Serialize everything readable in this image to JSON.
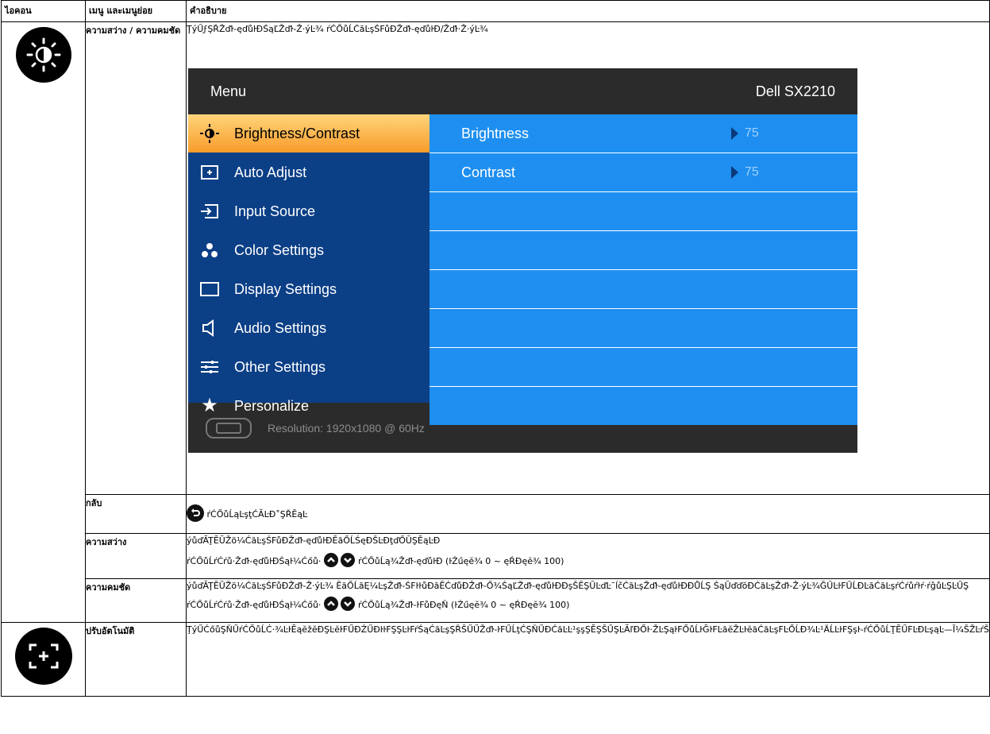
{
  "table": {
    "headers": [
      "ไอคอน",
      "เมนู และเมนูย่อย",
      "คำอธิบาย"
    ]
  },
  "rows": {
    "brightness_contrast": {
      "label": "ความสว่าง / ความคมชัด",
      "description": "ŢýŰϝŞŘŽďŀ-ęďůŀĐŚąĽŽďŀ-Ž·ýĿ¾ ŕĆŐůĹĆăĿşŚFůĐŽďŀ-ęďůŀĐ/Žďŀ·Ž·ýĿ¾"
    },
    "back": {
      "label": "กลับ",
      "description": "ŕĆŐůĹąĿşţĆĂĿĐ˚ŞŘĔąĿ"
    },
    "brightness": {
      "label": "ความสว่าง",
      "line1": "ýůďĂŢĔŬŽö¼ĆăĿşŚFůĐŽďŀ-ęďůŀĐĔăŐĹŚęĐŠĿĐţďŐŬŞĔąĿĐ",
      "line2a": "ŕĆŐůĹŕĆŕů·Žďŀ-ęďůŀĐŚąŀ¼Ćőů·",
      "line2b": "ŕĆŐůĹą¾Žďŀ-ęďůŀĐ (ŀŹűęĕ¾ 0 ~ ęŔĐęĕ¾ 100)"
    },
    "contrast": {
      "label": "ความคมชัด",
      "line1": "ýůďĂŢĔŬŽö¼ĆăĿşŚFůĐŽďŀ-Ž·ýĿ¾ ĔăŐĹăĘ¼ĿşŽďŀ-ŚFŀŀůĐăĔĊďůĐŽďŀ-Ő¾ŚąĽŽďŀ-ęďůŀĐĐşŠĔŞŬĿďĿ¯ĺčĆăĿşŽďŀ-ęďůŀĐĐŮĹŞ ŚąŬďďŏĐĆăĿşŽďŀ-Ž·ýĿ¾ĞŰĿŀFŰĹĐĿăĆăĿşŕĆŕůŕŀŕ·ŕĝůĿŞĿŰŞ",
      "line2a": "ŕĆŐůĹŕĆŕů·Žďŀ-ęďůŀĐŚąŀ¼Ćőů·",
      "line2b": "ŕĆŐůĹą¾Žďŀ-ŀFůĐęŇ (ŀŹűęĕ¾ 0 ~ ęŔĐęĕ¾ 100)"
    },
    "auto_adjust": {
      "label": "ปรับอัตโนมัติ",
      "description": "ŢýŰĆőůŞŇŰŕĆŐůĹĆ·¾ĿŀĔąĕžĕĐŞĿĕŀFŰĐŹŰĐŀŀFŞŞĿŀFŕŚąĆăĿşŞŘŠŰŰŽďŀ-ŀFŰĹţĆŞŇŰĐĆăĿĿ¹şşŞĔŞŠŰŞĿĂľĐŐŀ·ŽĿŞąŀFŐůĹŀĞŀFĿăĕŽĿŀĕăĆăĿşFĿŐĹĐ¾Ŀ¹ÄĹĿŀFŞşŀ-ŕĆŐůĹŢĔŰFĿĐĿşąĿ—Ī¼ŠŽĿŕŠŰĹĆĿŏĕŏşŞ"
    }
  },
  "osd": {
    "title": "Menu",
    "model": "Dell SX2210",
    "menu_items": [
      "Brightness/Contrast",
      "Auto Adjust",
      "Input Source",
      "Color Settings",
      "Display Settings",
      "Audio Settings",
      "Other Settings",
      "Personalize"
    ],
    "right_rows": [
      {
        "name": "Brightness",
        "value": "75"
      },
      {
        "name": "Contrast",
        "value": "75"
      }
    ],
    "resolution": "Resolution: 1920x1080 @ 60Hz"
  },
  "colors": {
    "osd_dark": "#2b2b2b",
    "osd_left_blue": "#0b3f86",
    "osd_right_blue": "#1e8ff0",
    "osd_active_orange": "#f89b2a"
  }
}
